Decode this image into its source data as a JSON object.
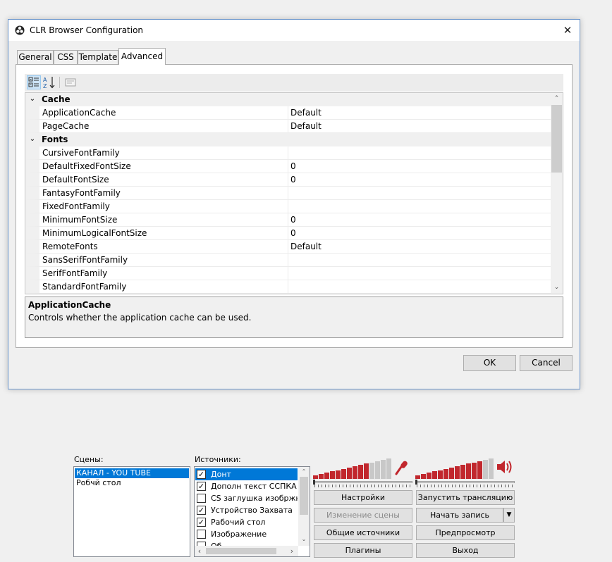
{
  "dialog": {
    "title": "CLR Browser Configuration",
    "close_glyph": "✕",
    "tabs": [
      {
        "label": "General"
      },
      {
        "label": "CSS"
      },
      {
        "label": "Template"
      },
      {
        "label": "Advanced",
        "active": true
      }
    ],
    "property_grid": {
      "categories": [
        {
          "name": "Cache",
          "expanded": true,
          "properties": [
            {
              "name": "ApplicationCache",
              "value": "Default"
            },
            {
              "name": "PageCache",
              "value": "Default"
            }
          ]
        },
        {
          "name": "Fonts",
          "expanded": true,
          "properties": [
            {
              "name": "CursiveFontFamily",
              "value": ""
            },
            {
              "name": "DefaultFixedFontSize",
              "value": "0"
            },
            {
              "name": "DefaultFontSize",
              "value": "0"
            },
            {
              "name": "FantasyFontFamily",
              "value": ""
            },
            {
              "name": "FixedFontFamily",
              "value": ""
            },
            {
              "name": "MinimumFontSize",
              "value": "0"
            },
            {
              "name": "MinimumLogicalFontSize",
              "value": "0"
            },
            {
              "name": "RemoteFonts",
              "value": "Default"
            },
            {
              "name": "SansSerifFontFamily",
              "value": ""
            },
            {
              "name": "SerifFontFamily",
              "value": ""
            },
            {
              "name": "StandardFontFamily",
              "value": ""
            }
          ]
        }
      ]
    },
    "help": {
      "title": "ApplicationCache",
      "description": "Controls whether the application cache can be used."
    },
    "buttons": {
      "ok": "OK",
      "cancel": "Cancel"
    }
  },
  "obs": {
    "scenes_label": "Сцены:",
    "scenes": [
      {
        "label": "КАНАЛ - YOU TUBE",
        "selected": true
      },
      {
        "label": "Робчй стол",
        "selected": false
      }
    ],
    "sources_label": "Источники:",
    "sources": [
      {
        "label": "Донт",
        "checked": true,
        "selected": true
      },
      {
        "label": "Дополн текст ССПКА В I",
        "checked": true,
        "selected": false
      },
      {
        "label": "CS заглушка изобржне",
        "checked": false,
        "selected": false
      },
      {
        "label": "Устройство Захвата",
        "checked": true,
        "selected": false
      },
      {
        "label": "Рабочий стол",
        "checked": true,
        "selected": false
      },
      {
        "label": "Изображение",
        "checked": false,
        "selected": false
      },
      {
        "label": "Об",
        "checked": false,
        "selected": false
      }
    ],
    "mic_level": 0.78,
    "desktop_level": 0.92,
    "buttons": {
      "settings": "Настройки",
      "start_stream": "Запустить трансляцию",
      "edit_scene": "Изменение сцены",
      "start_record": "Начать запись",
      "global_sources": "Общие источники",
      "preview": "Предпросмотр",
      "plugins": "Плагины",
      "exit": "Выход"
    },
    "colors": {
      "meter_active": "#c1272d",
      "meter_inactive": "#c8c8c8",
      "selection": "#0078d7"
    }
  }
}
